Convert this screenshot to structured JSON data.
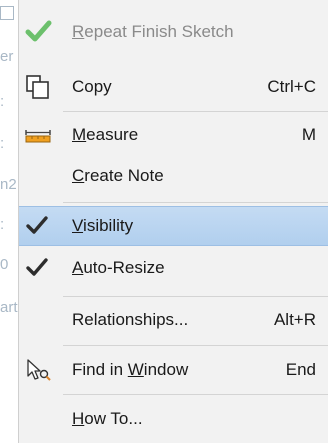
{
  "background": {
    "fragments": [
      "er Point",
      ":",
      ":",
      "n2",
      ":",
      "0",
      "art"
    ]
  },
  "menu": {
    "items": [
      {
        "id": "repeat",
        "pre": "",
        "ul": "R",
        "post": "epeat Finish Sketch",
        "shortcut": "",
        "icon": "green-check-icon",
        "disabled": true
      },
      {
        "id": "copy",
        "pre": "",
        "ul": "",
        "post": "Copy",
        "shortcut": "Ctrl+C",
        "icon": "copy-icon",
        "disabled": false
      },
      {
        "id": "measure",
        "pre": "",
        "ul": "M",
        "post": "easure",
        "shortcut": "M",
        "icon": "ruler-icon",
        "disabled": false
      },
      {
        "id": "create-note",
        "pre": "",
        "ul": "C",
        "post": "reate Note",
        "shortcut": "",
        "icon": "",
        "disabled": false
      },
      {
        "id": "visibility",
        "pre": "",
        "ul": "V",
        "post": "isibility",
        "shortcut": "",
        "icon": "checkmark-icon",
        "disabled": false,
        "highlighted": true
      },
      {
        "id": "auto-resize",
        "pre": "",
        "ul": "A",
        "post": "uto-Resize",
        "shortcut": "",
        "icon": "checkmark-icon",
        "disabled": false
      },
      {
        "id": "relationships",
        "pre": "",
        "ul": "",
        "post": "Relationships...",
        "shortcut": "Alt+R",
        "icon": "",
        "disabled": false
      },
      {
        "id": "find-in-window",
        "pre": "Find in ",
        "ul": "W",
        "post": "indow",
        "shortcut": "End",
        "icon": "find-cursor-icon",
        "disabled": false
      },
      {
        "id": "how-to",
        "pre": "",
        "ul": "H",
        "post": "ow To...",
        "shortcut": "",
        "icon": "",
        "disabled": false
      }
    ]
  },
  "colors": {
    "menu_bg": "#f2f2f2",
    "highlight": "#b1cfee",
    "check": "#2d2d2d",
    "green_check": "#5cb85c",
    "ruler": "#f0a020"
  }
}
